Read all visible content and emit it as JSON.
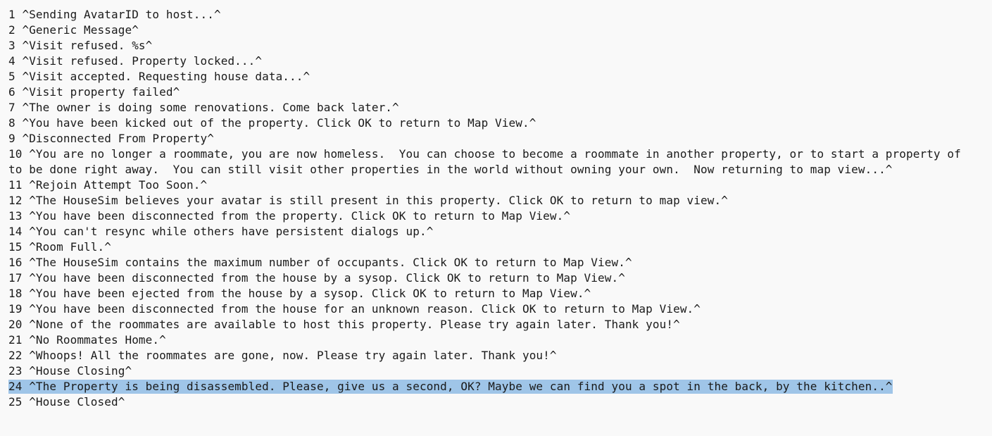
{
  "editor": {
    "selected_line": "24",
    "lines": [
      "1 ^Sending AvatarID to host...^",
      "2 ^Generic Message^",
      "3 ^Visit refused. %s^",
      "4 ^Visit refused. Property locked...^",
      "5 ^Visit accepted. Requesting house data...^",
      "6 ^Visit property failed^",
      "7 ^The owner is doing some renovations. Come back later.^",
      "8 ^You have been kicked out of the property. Click OK to return to Map View.^",
      "9 ^Disconnected From Property^",
      "10 ^You are no longer a roommate, you are now homeless.  You can choose to become a roommate in another property, or to start a property of",
      "to be done right away.  You can still visit other properties in the world without owning your own.  Now returning to map view...^",
      "11 ^Rejoin Attempt Too Soon.^",
      "12 ^The HouseSim believes your avatar is still present in this property. Click OK to return to map view.^",
      "13 ^You have been disconnected from the property. Click OK to return to Map View.^",
      "14 ^You can't resync while others have persistent dialogs up.^",
      "15 ^Room Full.^",
      "16 ^The HouseSim contains the maximum number of occupants. Click OK to return to Map View.^",
      "17 ^You have been disconnected from the house by a sysop. Click OK to return to Map View.^",
      "18 ^You have been ejected from the house by a sysop. Click OK to return to Map View.^",
      "19 ^You have been disconnected from the house for an unknown reason. Click OK to return to Map View.^",
      "20 ^None of the roommates are available to host this property. Please try again later. Thank you!^",
      "21 ^No Roommates Home.^",
      "22 ^Whoops! All the roommates are gone, now. Please try again later. Thank you!^",
      "23 ^House Closing^",
      "24 ^The Property is being disassembled. Please, give us a second, OK? Maybe we can find you a spot in the back, by the kitchen..^",
      "25 ^House Closed^"
    ]
  }
}
